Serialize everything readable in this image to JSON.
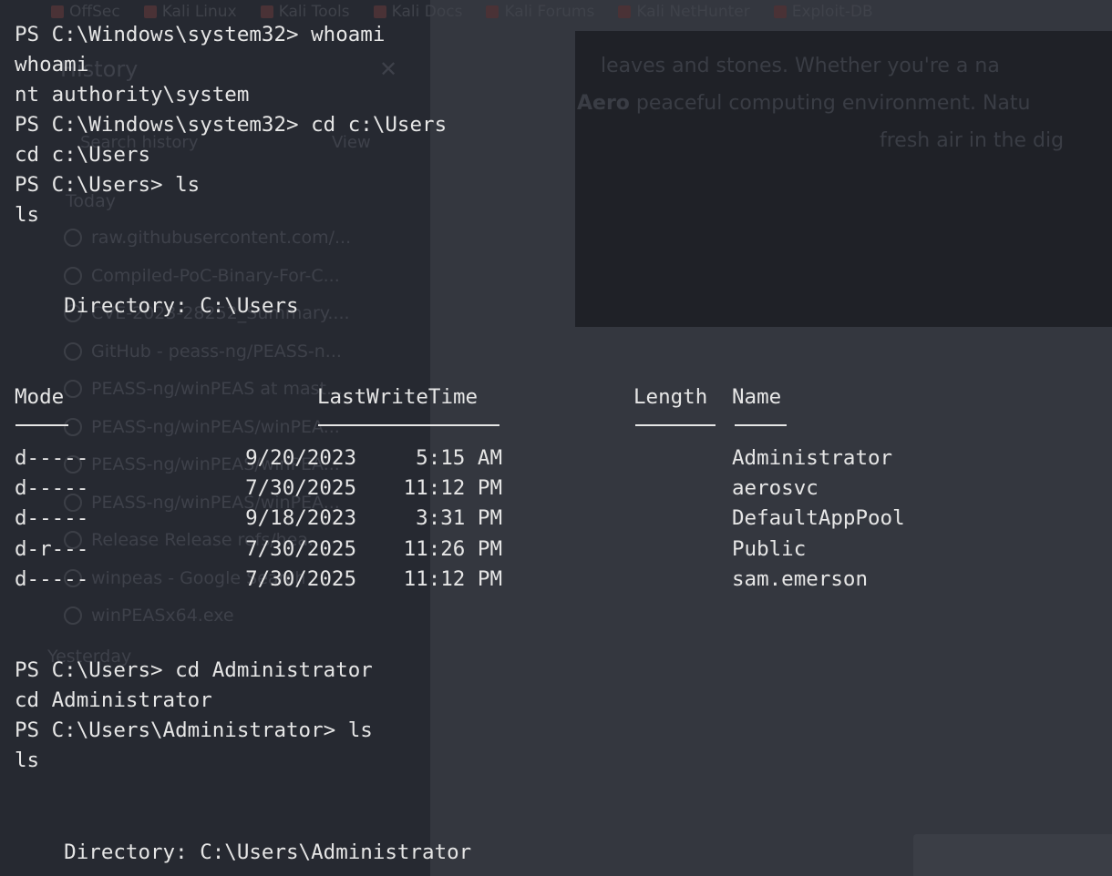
{
  "background_browser": {
    "bookmarks": [
      "OffSec",
      "Kali Linux",
      "Kali Tools",
      "Kali Docs",
      "Kali Forums",
      "Kali NetHunter",
      "Exploit-DB"
    ],
    "history_panel": {
      "title": "History",
      "search": "Search history",
      "view_label": "View",
      "today_label": "Today",
      "yesterday_label": "Yesterday",
      "entries": [
        "raw.githubusercontent.com/...",
        "Compiled-PoC-Binary-For-C...",
        "CVE-2023-28252_Summary....",
        "GitHub - peass-ng/PEASS-n...",
        "PEASS-ng/winPEAS at mast...",
        "PEASS-ng/winPEAS/winPEA...",
        "PEASS-ng/winPEAS/winPEA...",
        "PEASS-ng/winPEAS/winPEA...",
        "Release Release refs/hea...",
        "winpeas - Google Search",
        "winPEASx64.exe"
      ]
    },
    "article": {
      "line1": "leaves and stones. Whether you're a na",
      "line2_bold": "Aero",
      "line2_rest": " peaceful computing environment. Natu",
      "line3": "fresh air in the dig"
    }
  },
  "terminal": {
    "lines": [
      "PS C:\\Windows\\system32> whoami",
      "whoami",
      "nt authority\\system",
      "PS C:\\Windows\\system32> cd c:\\Users",
      "cd c:\\Users",
      "PS C:\\Users> ls",
      "ls"
    ],
    "directory_1": "    Directory: C:\\Users",
    "columns": {
      "mode": "Mode",
      "last_write_time": "LastWriteTime",
      "length": "Length",
      "name": "Name"
    },
    "entries": [
      {
        "mode": "d-----",
        "date": "9/20/2023",
        "time": "5:15 AM",
        "name": "Administrator"
      },
      {
        "mode": "d-----",
        "date": "7/30/2025",
        "time": "11:12 PM",
        "name": "aerosvc"
      },
      {
        "mode": "d-----",
        "date": "9/18/2023",
        "time": "3:31 PM",
        "name": "DefaultAppPool"
      },
      {
        "mode": "d-r---",
        "date": "7/30/2025",
        "time": "11:26 PM",
        "name": "Public"
      },
      {
        "mode": "d-----",
        "date": "7/30/2025",
        "time": "11:12 PM",
        "name": "sam.emerson"
      }
    ],
    "lines_after": [
      "PS C:\\Users> cd Administrator",
      "cd Administrator",
      "PS C:\\Users\\Administrator> ls",
      "ls"
    ],
    "directory_2": "    Directory: C:\\Users\\Administrator"
  }
}
